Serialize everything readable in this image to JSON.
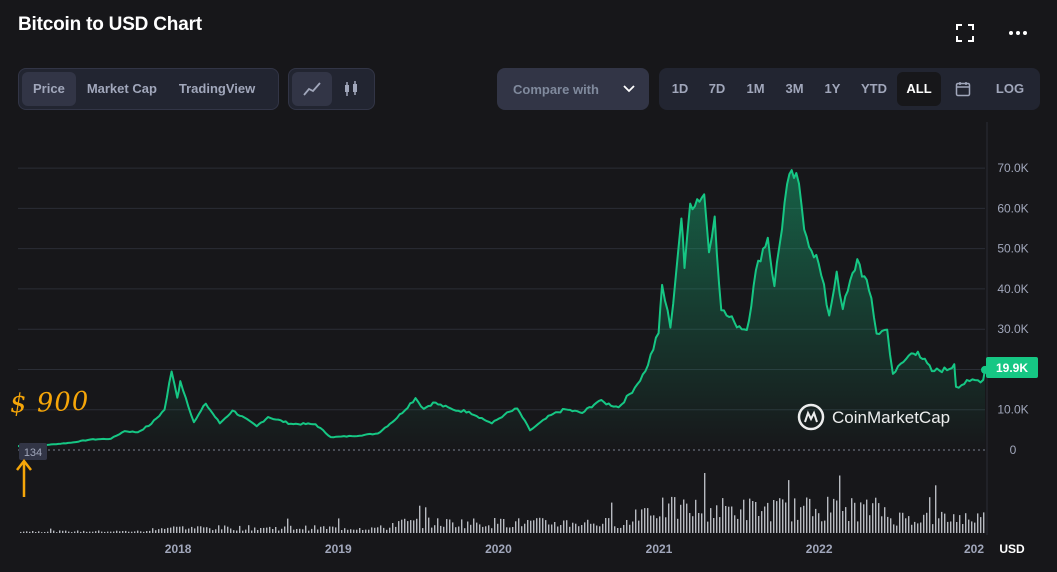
{
  "header": {
    "title": "Bitcoin to USD Chart",
    "fullscreen_icon": "expand-icon",
    "more_icon": "more-dots-icon"
  },
  "view_tabs": [
    "Price",
    "Market Cap",
    "TradingView"
  ],
  "view_tab_active": "Price",
  "chart_type_toggle": [
    "line-chart-icon",
    "candlestick-icon"
  ],
  "compare": {
    "label": "Compare with",
    "icon": "chevron-down-icon"
  },
  "ranges": [
    "1D",
    "7D",
    "1M",
    "3M",
    "1Y",
    "YTD",
    "ALL"
  ],
  "range_active": "ALL",
  "calendar_icon": "calendar-icon",
  "log_label": "LOG",
  "colors": {
    "background": "#17171a",
    "line": "#16c784",
    "annotation": "#f6a609",
    "grid": "#2b2e36",
    "axis_text": "#a1a7bb"
  },
  "annotation": {
    "text": "$ 900"
  },
  "watermark": {
    "text": "CoinMarketCap",
    "icon": "coinmarketcap-logo-icon"
  },
  "chart_data": {
    "type": "area",
    "title": "Bitcoin to USD Chart",
    "currency_label": "USD",
    "y_ticks": [
      "70.0K",
      "60.0K",
      "50.0K",
      "40.0K",
      "30.0K",
      "20.0K",
      "10.0K",
      "0"
    ],
    "ylim": [
      0,
      75000
    ],
    "x_ticks": [
      "2018",
      "2019",
      "2020",
      "2021",
      "2022",
      "202"
    ],
    "current_price_label": "19.9K",
    "current_price": 19900,
    "start_price_label": "134",
    "grid": true,
    "series": [
      {
        "values": [
          [
            "2017-01-01",
            960
          ],
          [
            "2017-03-01",
            1200
          ],
          [
            "2017-05-01",
            1800
          ],
          [
            "2017-06-15",
            2600
          ],
          [
            "2017-08-01",
            2800
          ],
          [
            "2017-09-01",
            4700
          ],
          [
            "2017-10-01",
            4400
          ],
          [
            "2017-11-01",
            6500
          ],
          [
            "2017-12-01",
            10000
          ],
          [
            "2017-12-17",
            19500
          ],
          [
            "2017-12-30",
            13000
          ],
          [
            "2018-01-06",
            17100
          ],
          [
            "2018-02-06",
            6900
          ],
          [
            "2018-03-05",
            11500
          ],
          [
            "2018-04-06",
            6600
          ],
          [
            "2018-05-05",
            9800
          ],
          [
            "2018-06-29",
            5900
          ],
          [
            "2018-07-25",
            8200
          ],
          [
            "2018-09-15",
            6500
          ],
          [
            "2018-11-10",
            6400
          ],
          [
            "2018-12-15",
            3200
          ],
          [
            "2019-02-01",
            3450
          ],
          [
            "2019-04-01",
            4100
          ],
          [
            "2019-05-15",
            8000
          ],
          [
            "2019-06-26",
            12900
          ],
          [
            "2019-07-15",
            10200
          ],
          [
            "2019-08-05",
            11800
          ],
          [
            "2019-09-20",
            10000
          ],
          [
            "2019-10-26",
            9500
          ],
          [
            "2019-12-17",
            6600
          ],
          [
            "2020-01-15",
            8800
          ],
          [
            "2020-02-13",
            10300
          ],
          [
            "2020-03-13",
            4900
          ],
          [
            "2020-04-30",
            8700
          ],
          [
            "2020-06-01",
            10100
          ],
          [
            "2020-07-10",
            9200
          ],
          [
            "2020-08-17",
            12200
          ],
          [
            "2020-10-01",
            10600
          ],
          [
            "2020-11-07",
            15500
          ],
          [
            "2020-12-01",
            19600
          ],
          [
            "2020-12-31",
            29000
          ],
          [
            "2021-01-08",
            41000
          ],
          [
            "2021-01-27",
            30400
          ],
          [
            "2021-02-21",
            57500
          ],
          [
            "2021-02-28",
            45200
          ],
          [
            "2021-03-13",
            61200
          ],
          [
            "2021-04-14",
            63500
          ],
          [
            "2021-04-25",
            49100
          ],
          [
            "2021-05-08",
            58000
          ],
          [
            "2021-05-23",
            34700
          ],
          [
            "2021-06-22",
            31700
          ],
          [
            "2021-07-20",
            29800
          ],
          [
            "2021-08-15",
            47000
          ],
          [
            "2021-09-06",
            52700
          ],
          [
            "2021-09-21",
            40700
          ],
          [
            "2021-10-20",
            66000
          ],
          [
            "2021-11-10",
            68800
          ],
          [
            "2021-11-28",
            54700
          ],
          [
            "2021-12-31",
            46300
          ],
          [
            "2022-01-24",
            33400
          ],
          [
            "2022-02-10",
            44300
          ],
          [
            "2022-02-24",
            35000
          ],
          [
            "2022-03-29",
            47400
          ],
          [
            "2022-04-30",
            37700
          ],
          [
            "2022-05-12",
            28900
          ],
          [
            "2022-06-05",
            29900
          ],
          [
            "2022-06-18",
            18900
          ],
          [
            "2022-07-30",
            24000
          ],
          [
            "2022-08-14",
            24400
          ],
          [
            "2022-09-15",
            19600
          ],
          [
            "2022-10-25",
            20100
          ],
          [
            "2022-11-05",
            21300
          ],
          [
            "2022-11-09",
            15700
          ],
          [
            "2022-12-10",
            17100
          ],
          [
            "2023-01-10",
            17400
          ],
          [
            "2023-01-14",
            19900
          ]
        ]
      }
    ],
    "volume_peaks": [
      "2021-01",
      "2021-05",
      "2022-11"
    ]
  }
}
